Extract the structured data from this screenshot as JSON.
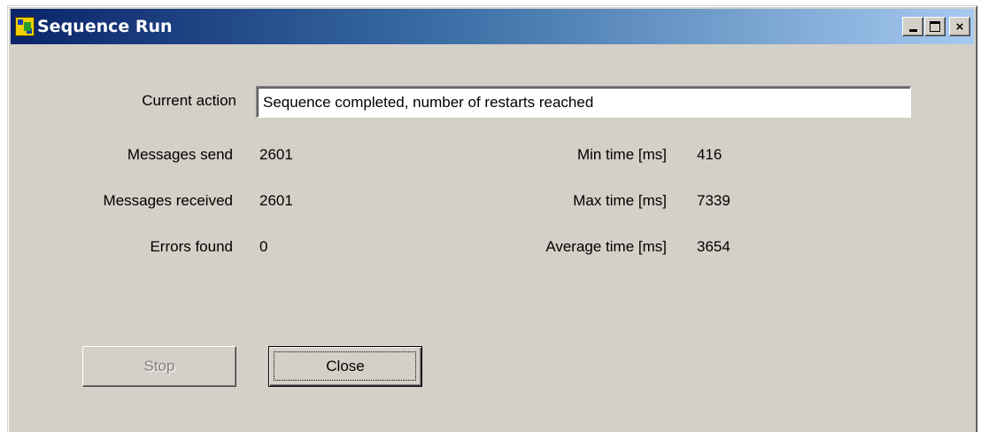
{
  "window": {
    "title": "Sequence Run",
    "controls": {
      "minimize": "",
      "maximize": "",
      "close": "×"
    }
  },
  "current_action": {
    "label": "Current action",
    "value": "Sequence completed, number of restarts reached"
  },
  "stats": {
    "messages_send": {
      "label": "Messages send",
      "value": "2601"
    },
    "messages_received": {
      "label": "Messages received",
      "value": "2601"
    },
    "errors_found": {
      "label": "Errors found",
      "value": "0"
    },
    "min_time": {
      "label": "Min time [ms]",
      "value": "416"
    },
    "max_time": {
      "label": "Max time [ms]",
      "value": "7339"
    },
    "average_time": {
      "label": "Average time [ms]",
      "value": "3654"
    }
  },
  "buttons": {
    "stop": "Stop",
    "close": "Close"
  },
  "colors": {
    "titlebar_start": "#0a246a",
    "titlebar_end": "#a6caf0",
    "dialog_face": "#d4d0c8"
  }
}
